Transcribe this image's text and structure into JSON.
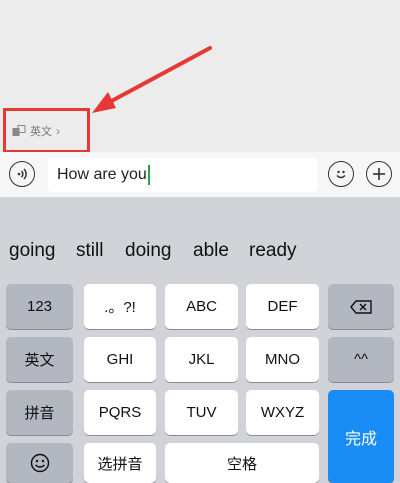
{
  "translate_chip": {
    "icon": "translate-icon",
    "label": "英文",
    "chevron": "›"
  },
  "input_bar": {
    "voice_icon": "voice-icon",
    "text_value": "How are you",
    "emoji_icon": "emoji-icon",
    "plus_icon": "plus-icon"
  },
  "suggestions": [
    "going",
    "still",
    "doing",
    "able",
    "ready"
  ],
  "keys": {
    "row1": [
      "123",
      ".。?!",
      "ABC",
      "DEF"
    ],
    "backspace_icon": "backspace-icon",
    "row2": [
      "英文",
      "GHI",
      "JKL",
      "MNO",
      "^^"
    ],
    "row3": [
      "拼音",
      "PQRS",
      "TUV",
      "WXYZ"
    ],
    "row4_emoji_icon": "emoji-icon",
    "row4": [
      "选拼音",
      "空格"
    ],
    "done": "完成"
  },
  "colors": {
    "highlight": "#e53935",
    "done_key": "#1a8cf5",
    "caret": "#2aa34a"
  }
}
